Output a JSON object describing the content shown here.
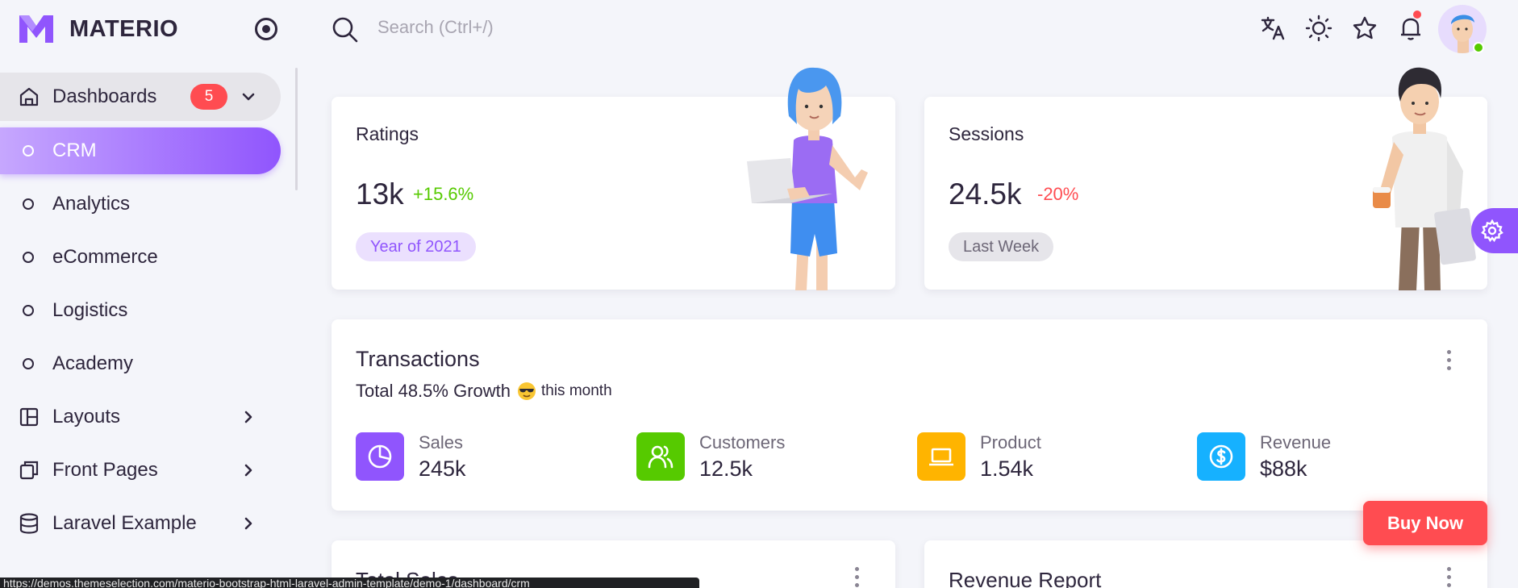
{
  "brand": {
    "name": "MATERIO",
    "color": "#9055fd"
  },
  "search": {
    "placeholder": "Search (Ctrl+/)"
  },
  "sidebar": {
    "dashboards": {
      "label": "Dashboards",
      "badge": "5"
    },
    "sub_items": [
      {
        "label": "CRM",
        "active": true
      },
      {
        "label": "Analytics"
      },
      {
        "label": "eCommerce"
      },
      {
        "label": "Logistics"
      },
      {
        "label": "Academy"
      }
    ],
    "groups": [
      {
        "label": "Layouts",
        "icon": "layout-icon"
      },
      {
        "label": "Front Pages",
        "icon": "files-icon"
      },
      {
        "label": "Laravel Example",
        "icon": "database-icon"
      }
    ]
  },
  "ratings": {
    "title": "Ratings",
    "value": "13k",
    "change": "+15.6%",
    "chip": "Year of 2021"
  },
  "sessions": {
    "title": "Sessions",
    "value": "24.5k",
    "change": "-20%",
    "chip": "Last Week"
  },
  "transactions": {
    "title": "Transactions",
    "subtitle_strong": "Total 48.5% Growth",
    "subtitle_tail": "this month",
    "metrics": [
      {
        "label": "Sales",
        "value": "245k",
        "color": "#9055fd",
        "icon": "pie-chart-icon"
      },
      {
        "label": "Customers",
        "value": "12.5k",
        "color": "#56ca00",
        "icon": "users-icon"
      },
      {
        "label": "Product",
        "value": "1.54k",
        "color": "#ffb400",
        "icon": "laptop-icon"
      },
      {
        "label": "Revenue",
        "value": "$88k",
        "color": "#16b1ff",
        "icon": "dollar-icon"
      }
    ]
  },
  "bottom_cards": {
    "left_title": "Total Sales",
    "right_title": "Revenue Report"
  },
  "buy_now": "Buy Now",
  "status_bar": "https://demos.themeselection.com/materio-bootstrap-html-laravel-admin-template/demo-1/dashboard/crm"
}
